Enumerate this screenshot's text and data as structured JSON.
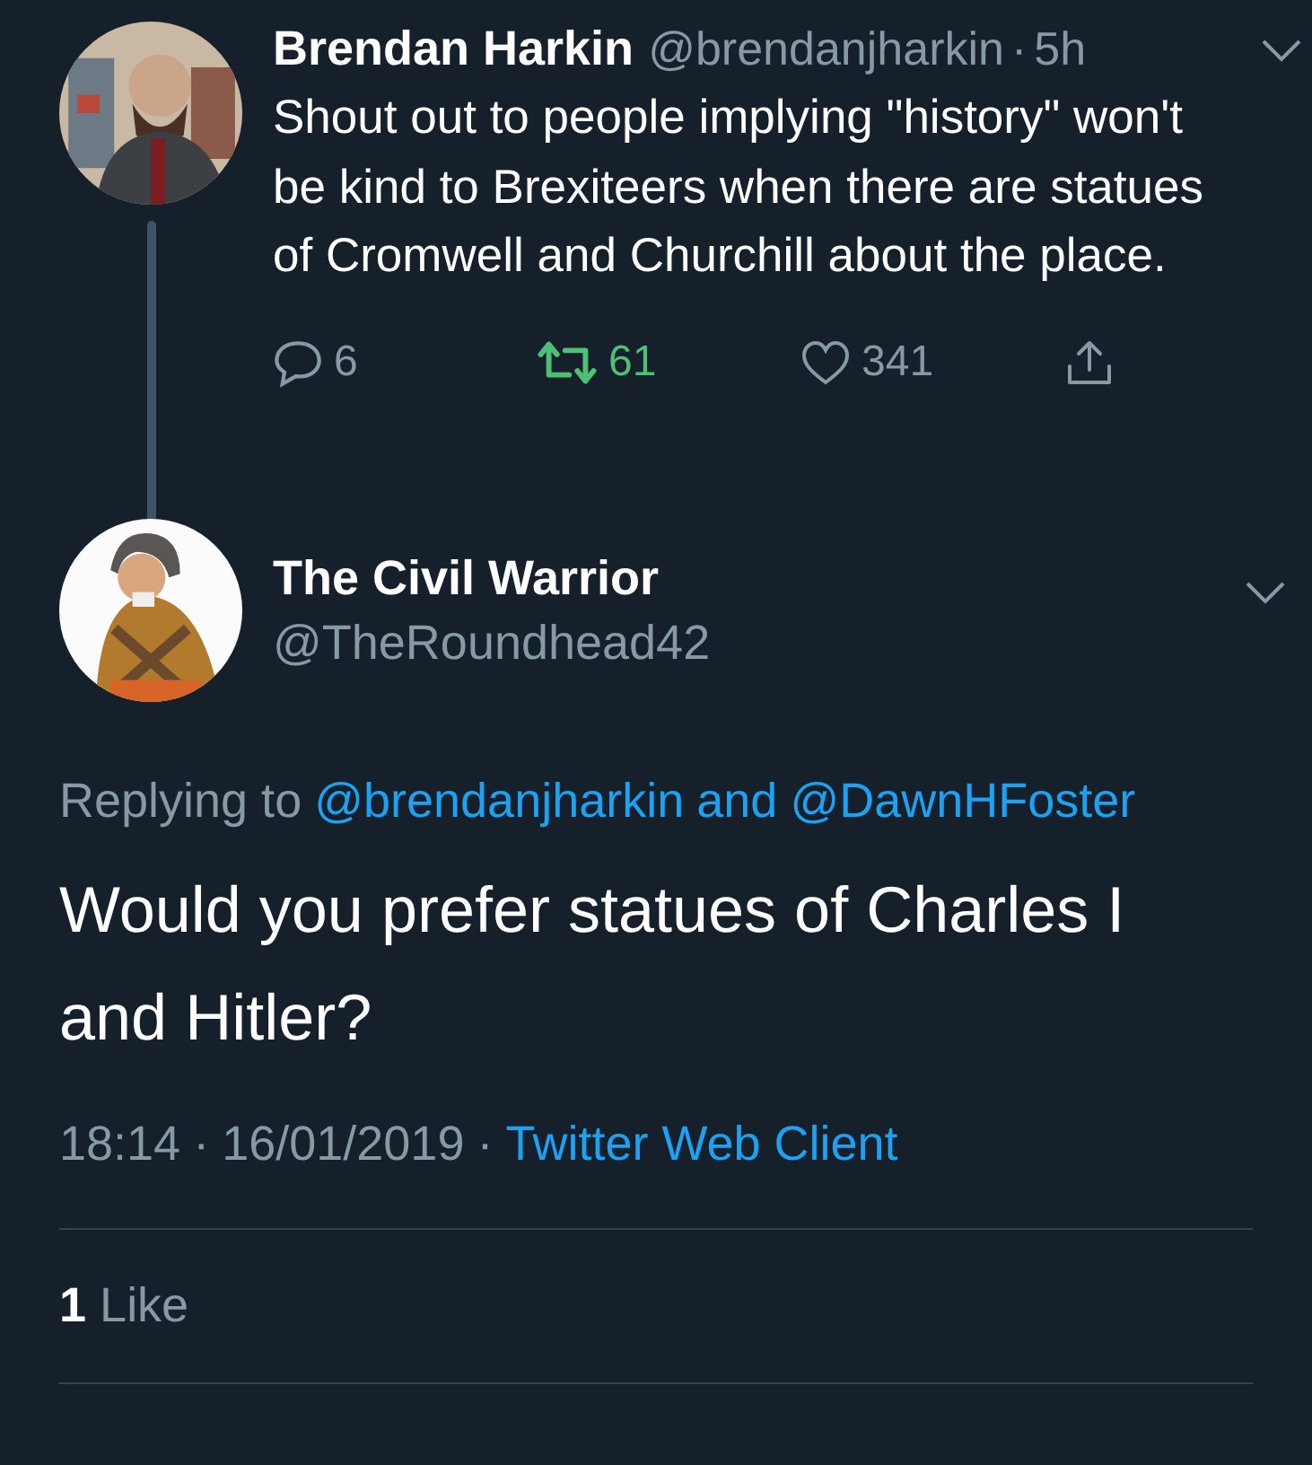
{
  "parent_tweet": {
    "name": "Brendan Harkin",
    "handle": "@brendanjharkin",
    "separator": "·",
    "time": "5h",
    "text": "Shout out to people implying \"history\" won't be kind to Brexiteers when there are statues of Cromwell and Churchill about the place.",
    "actions": [
      {
        "kind": "reply",
        "count": "6",
        "active": false
      },
      {
        "kind": "retweet",
        "count": "61",
        "active": true
      },
      {
        "kind": "like",
        "count": "341",
        "active": false
      },
      {
        "kind": "share",
        "active": false
      }
    ]
  },
  "main_tweet": {
    "name": "The Civil Warrior",
    "handle": "@TheRoundhead42",
    "replying_to": {
      "prefix": "Replying to",
      "users": [
        "@brendanjharkin",
        "@DawnHFoster"
      ],
      "joiner": "and"
    },
    "text": "Would you prefer statues of Charles I and Hitler?",
    "time": "18:14",
    "separator_1": "·",
    "date": "16/01/2019",
    "separator_2": "·",
    "client": "Twitter Web Client",
    "stats": [
      {
        "count": "1",
        "label": "Like"
      }
    ]
  }
}
